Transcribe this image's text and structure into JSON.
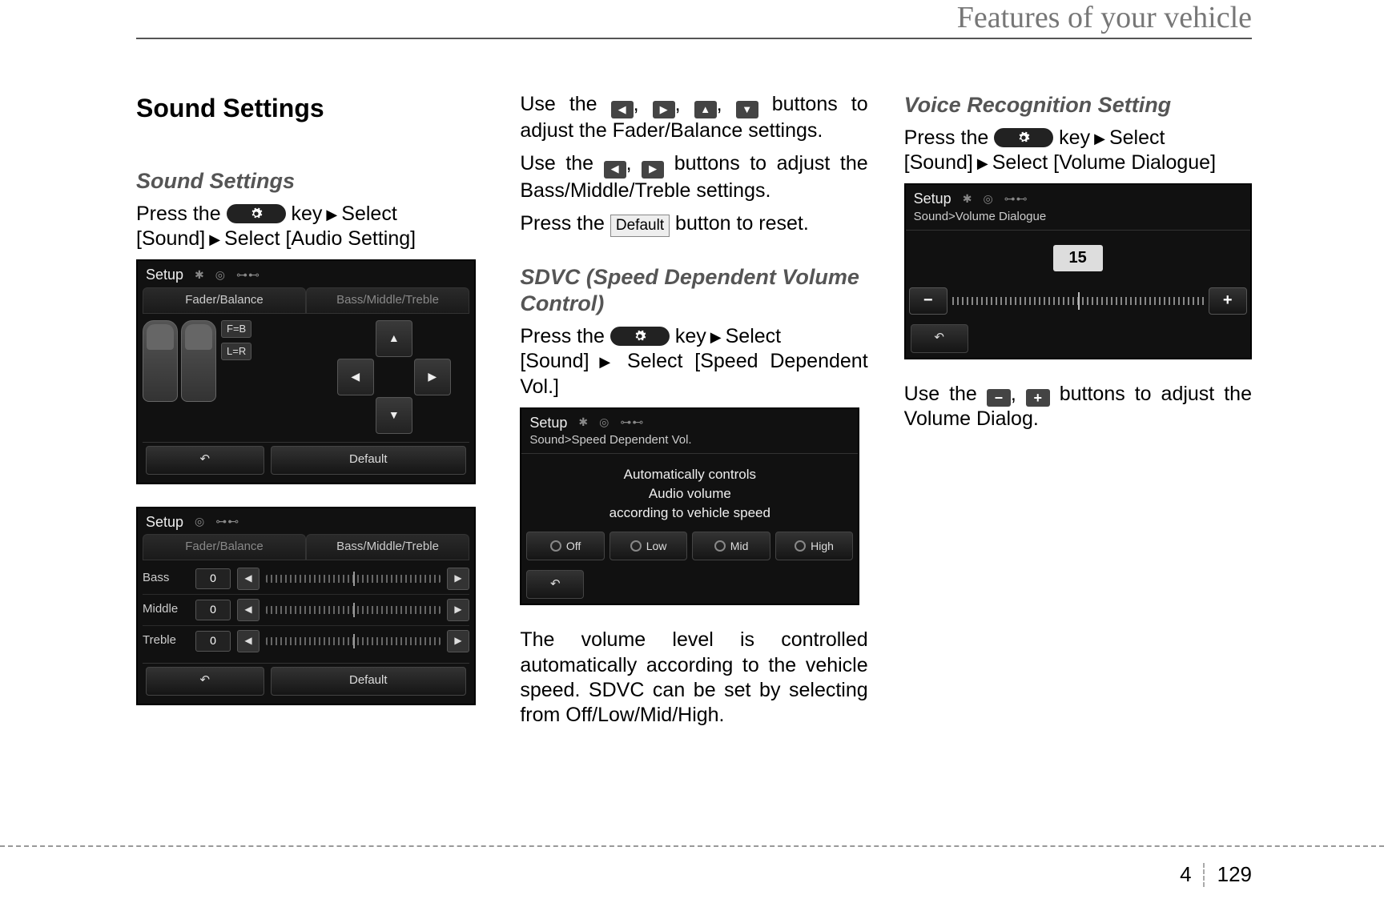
{
  "header": {
    "title": "Features of your vehicle"
  },
  "footer": {
    "section": "4",
    "page": "129"
  },
  "col1": {
    "h1": "Sound Settings",
    "h2": "Sound Settings",
    "para": {
      "press_the": "Press the ",
      "key": " key",
      "select": "Select",
      "sound": "[Sound]",
      "select2": "Select [Audio Setting]"
    }
  },
  "col2": {
    "para1_a": "Use the ",
    "para1_b": " buttons to adjust the Fader/Balance settings.",
    "para2_a": "Use the ",
    "para2_b": " buttons to adjust the Bass/Middle/Treble settings.",
    "para3_a": "Press the ",
    "para3_b": " button to reset.",
    "default_label": "Default",
    "h2": "SDVC (Speed Dependent Volume Control)",
    "press_the": "Press the ",
    "key": " key",
    "select": "Select",
    "sound": "[Sound]",
    "select2": "Select [Speed Dependent Vol.]",
    "para4": "The volume level is controlled automatically according to the vehicle speed. SDVC can be set by selecting from Off/Low/Mid/High."
  },
  "col3": {
    "h2": "Voice Recognition Setting",
    "press_the": "Press the ",
    "key": " key",
    "select": "Select",
    "sound": "[Sound]",
    "select2": "Select [Volume Dialogue]",
    "para_a": "Use the ",
    "para_b": " buttons to adjust the Volume Dialog."
  },
  "shot1": {
    "title": "Setup",
    "tab1": "Fader/Balance",
    "tab2": "Bass/Middle/Treble",
    "badge1": "F=B",
    "badge2": "L=R",
    "default": "Default"
  },
  "shot2": {
    "title": "Setup",
    "tab1": "Fader/Balance",
    "tab2": "Bass/Middle/Treble",
    "rows": [
      {
        "label": "Bass",
        "val": "0"
      },
      {
        "label": "Middle",
        "val": "0"
      },
      {
        "label": "Treble",
        "val": "0"
      }
    ],
    "default": "Default"
  },
  "shot3": {
    "title": "Setup",
    "breadcrumb": "Sound>Speed Dependent Vol.",
    "line1": "Automatically controls",
    "line2": "Audio volume",
    "line3": "according to vehicle speed",
    "opts": [
      "Off",
      "Low",
      "Mid",
      "High"
    ]
  },
  "shot4": {
    "title": "Setup",
    "breadcrumb": "Sound>Volume Dialogue",
    "value": "15"
  }
}
